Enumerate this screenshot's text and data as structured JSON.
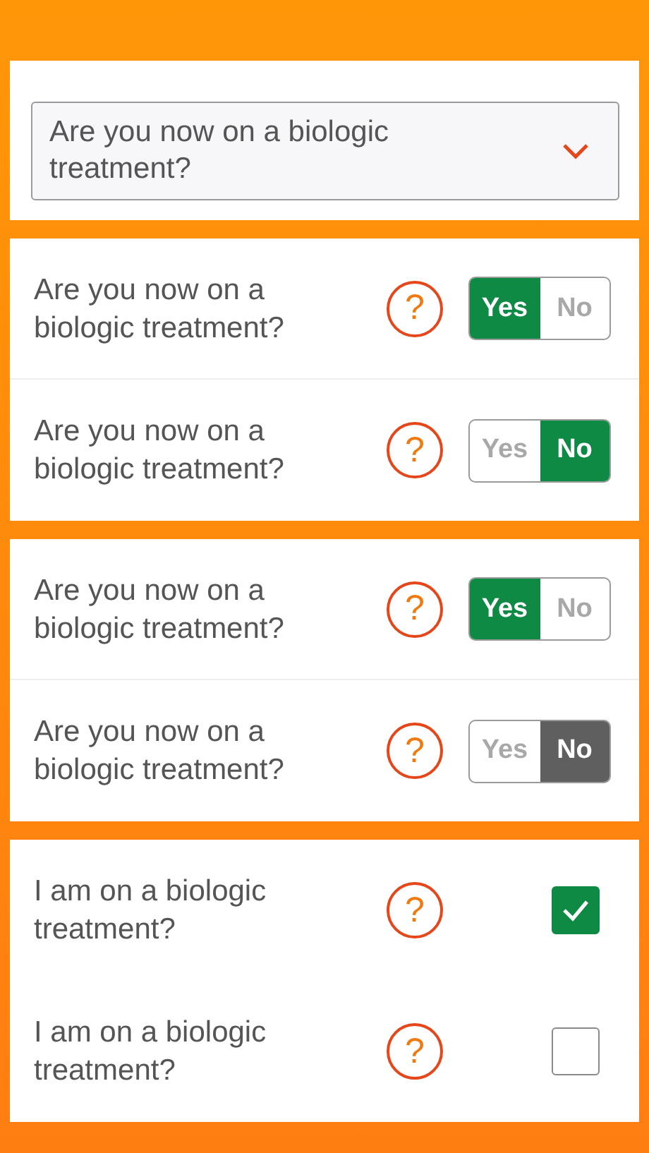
{
  "sections": [
    {
      "kind": "dropdown",
      "value": "Are you now on a biologic treatment?"
    },
    {
      "kind": "toggles",
      "rows": [
        {
          "question": "Are you now on a biologic treatment?",
          "help": "?",
          "color": "#0f8a45",
          "options": [
            {
              "label": "Yes",
              "selected": true
            },
            {
              "label": "No",
              "selected": false
            }
          ]
        },
        {
          "question": "Are you now on a biologic treatment?",
          "help": "?",
          "color": "#0f8a45",
          "options": [
            {
              "label": "Yes",
              "selected": false
            },
            {
              "label": "No",
              "selected": true
            }
          ]
        }
      ]
    },
    {
      "kind": "toggles",
      "rows": [
        {
          "question": "Are you now on a biologic treatment?",
          "help": "?",
          "color": "#0f8a45",
          "options": [
            {
              "label": "Yes",
              "selected": true
            },
            {
              "label": "No",
              "selected": false
            }
          ]
        },
        {
          "question": "Are you now on a biologic treatment?",
          "help": "?",
          "color": "#5f5f5f",
          "options": [
            {
              "label": "Yes",
              "selected": false
            },
            {
              "label": "No",
              "selected": true
            }
          ]
        }
      ]
    },
    {
      "kind": "checks",
      "rows": [
        {
          "question": "I am on a biologic treatment?",
          "help": "?",
          "checked": true
        },
        {
          "question": "I am on a biologic treatment?",
          "help": "?",
          "checked": false
        }
      ]
    }
  ]
}
